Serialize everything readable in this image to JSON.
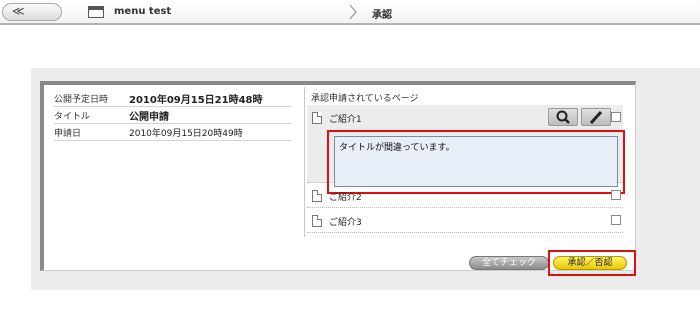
{
  "topbar": {
    "back_label": "≪",
    "menu_title": "menu test",
    "breadcrumb_current": "承認"
  },
  "info": {
    "rows": [
      {
        "key": "公開予定日時",
        "value": "2010年09月15日21時48時"
      },
      {
        "key": "タイトル",
        "value": "公開申請"
      },
      {
        "key": "申請日",
        "value": "2010年09月15日20時49時"
      }
    ]
  },
  "pages": {
    "title": "承認申請されているページ",
    "items": [
      {
        "label": "ご紹介1",
        "comment": "タイトルが間違っています。"
      },
      {
        "label": "ご紹介2"
      },
      {
        "label": "ご紹介3"
      }
    ]
  },
  "buttons": {
    "check_all": "全てチェック",
    "approve": "承認／否認"
  }
}
